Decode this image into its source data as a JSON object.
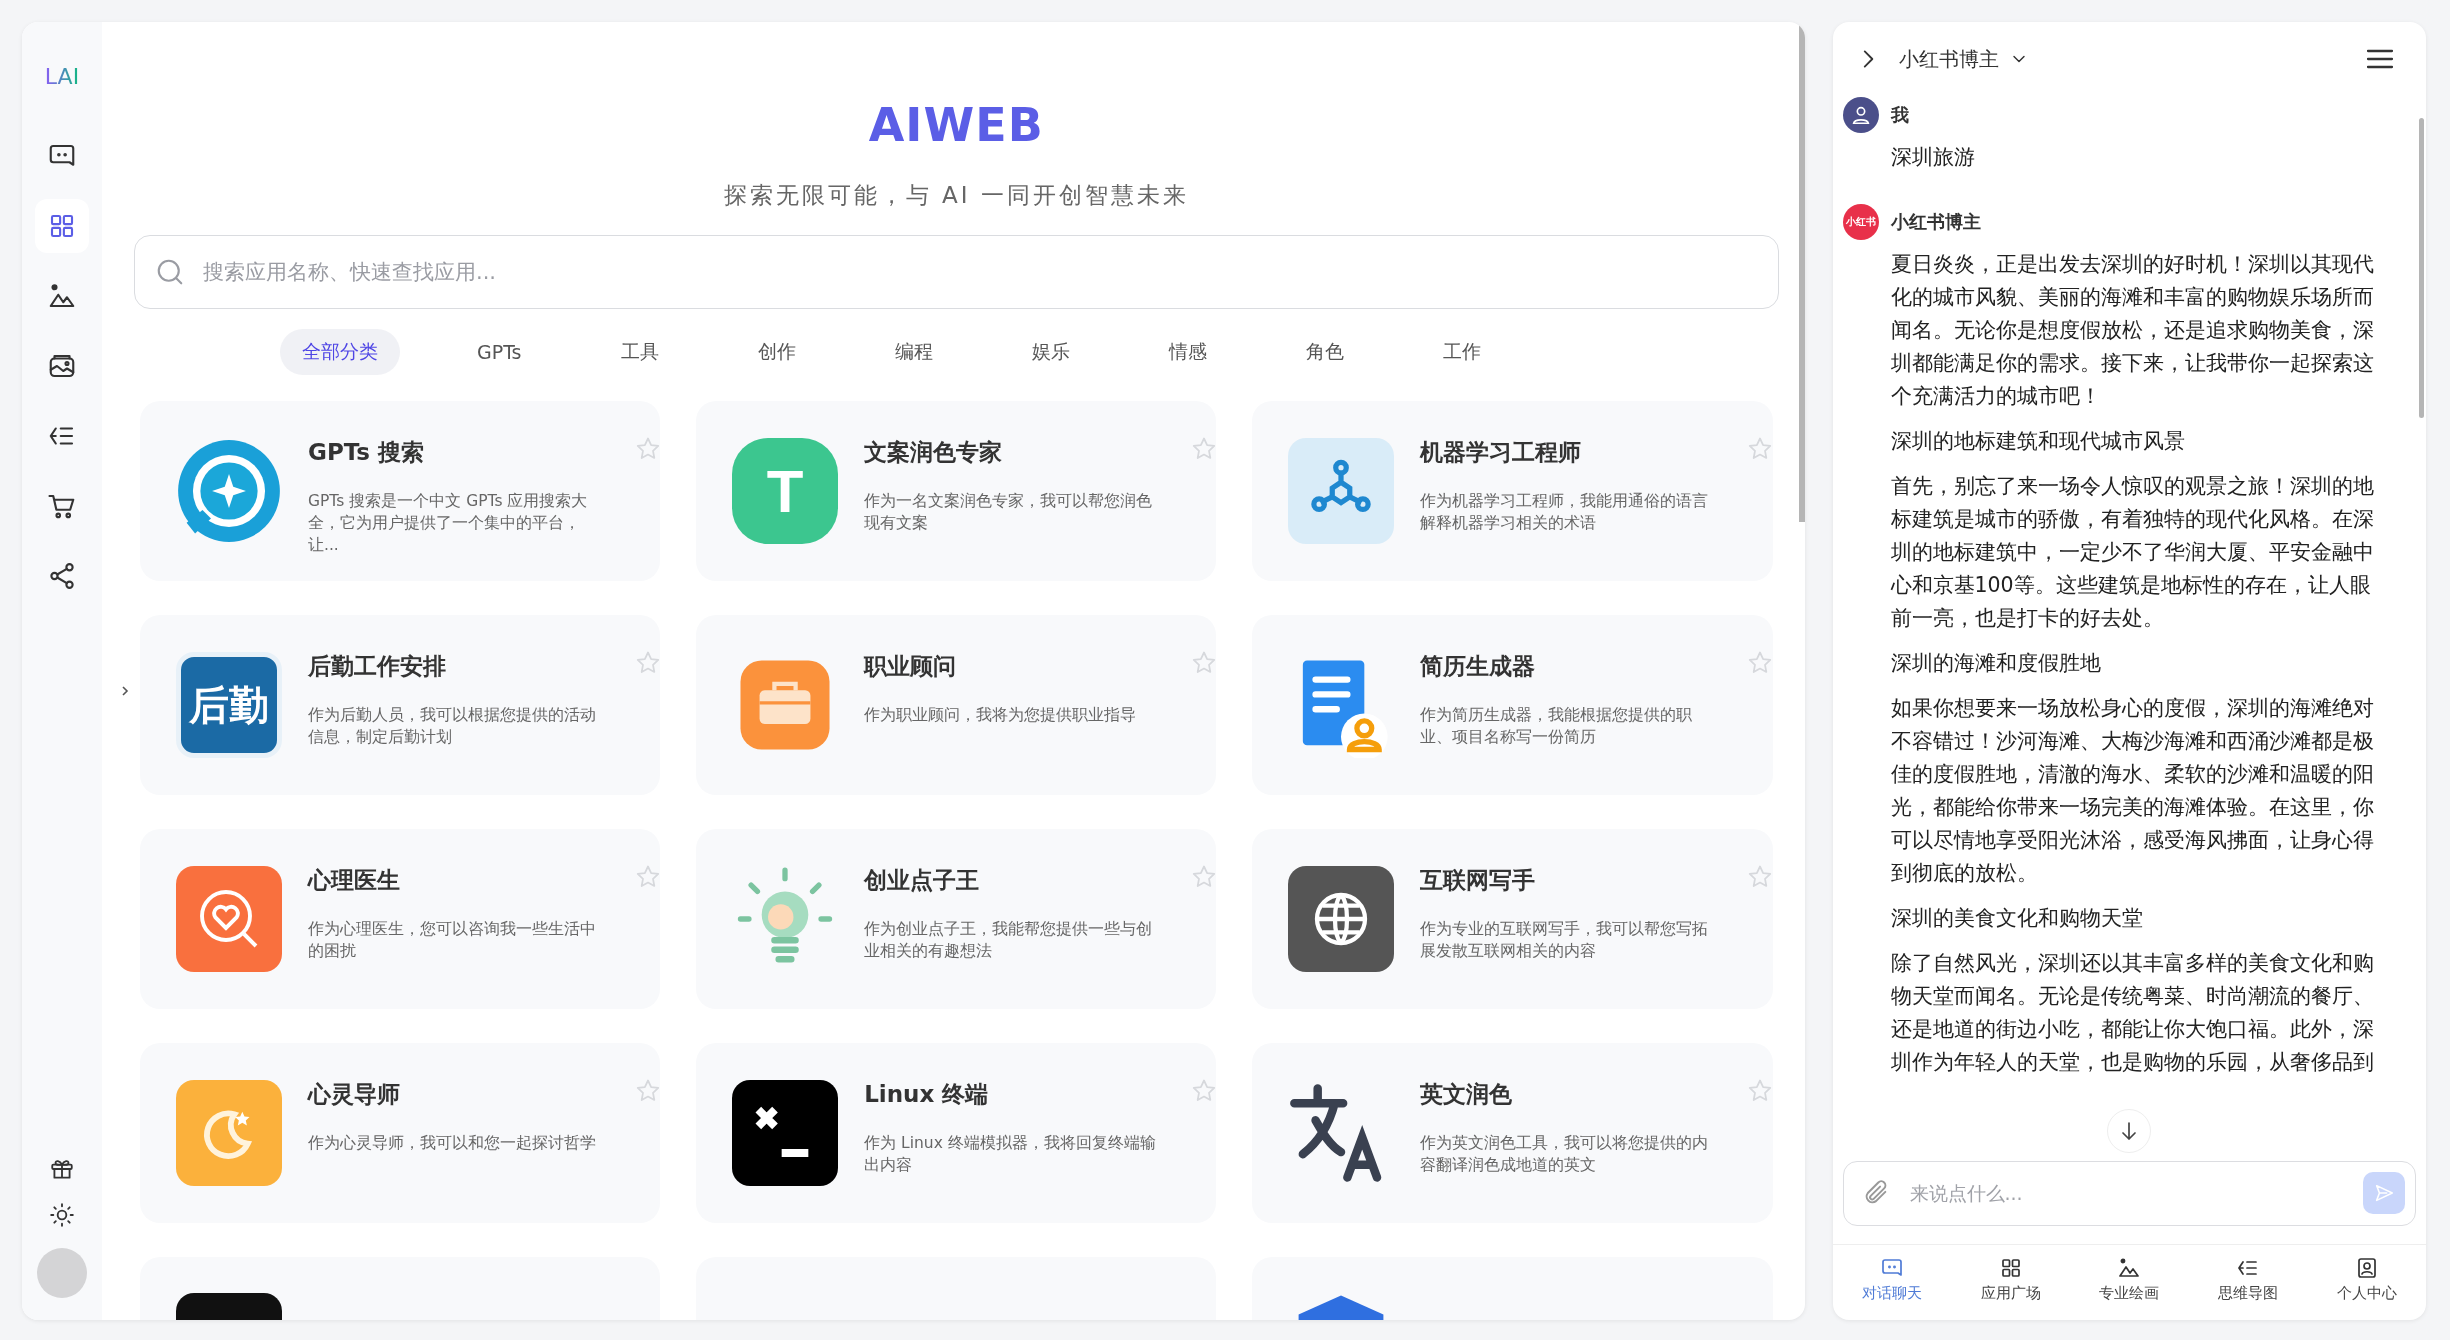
{
  "sidebar": {
    "logo": "LAI",
    "items": [
      {
        "kind": "chat",
        "selected": false
      },
      {
        "kind": "grid",
        "selected": true
      },
      {
        "kind": "paint",
        "selected": false
      },
      {
        "kind": "wallet",
        "selected": false
      },
      {
        "kind": "mindmap",
        "selected": false
      },
      {
        "kind": "cart",
        "selected": false
      },
      {
        "kind": "share",
        "selected": false
      }
    ],
    "bottom_items": [
      {
        "kind": "gift"
      },
      {
        "kind": "sun"
      }
    ]
  },
  "header": {
    "title": "AIWEB",
    "subtitle": "探索无限可能，与 AI 一同开创智慧未来"
  },
  "search": {
    "placeholder": "搜索应用名称、快速查找应用..."
  },
  "tabs": [
    {
      "label": "全部分类",
      "selected": true
    },
    {
      "label": "GPTs",
      "selected": false
    },
    {
      "label": "工具",
      "selected": false
    },
    {
      "label": "创作",
      "selected": false
    },
    {
      "label": "编程",
      "selected": false
    },
    {
      "label": "娱乐",
      "selected": false
    },
    {
      "label": "情感",
      "selected": false
    },
    {
      "label": "角色",
      "selected": false
    },
    {
      "label": "工作",
      "selected": false
    }
  ],
  "cards": [
    {
      "kind": "search-logo",
      "title": "GPTs 搜索",
      "description": "GPTs 搜索是一个中文 GPTs 应用搜索大全，它为用户提供了一个集中的平台，让...",
      "favorite": false
    },
    {
      "kind": "letter",
      "icon_text": "T",
      "title": "文案润色专家",
      "description": "作为一名文案润色专家，我可以帮您润色现有文案",
      "favorite": false
    },
    {
      "kind": "network",
      "title": "机器学习工程师",
      "description": "作为机器学习工程师，我能用通俗的语言解释机器学习相关的术语",
      "favorite": false
    },
    {
      "kind": "glyph",
      "icon_text": "后勤",
      "title": "后勤工作安排",
      "description": "作为后勤人员，我可以根据您提供的活动信息，制定后勤计划",
      "favorite": false
    },
    {
      "kind": "briefcase",
      "title": "职业顾问",
      "description": "作为职业顾问，我将为您提供职业指导",
      "favorite": false
    },
    {
      "kind": "resume",
      "title": "简历生成器",
      "description": "作为简历生成器，我能根据您提供的职业、项目名称写一份简历",
      "favorite": false
    },
    {
      "kind": "heart",
      "title": "心理医生",
      "description": "作为心理医生，您可以咨询我一些生活中的困扰",
      "favorite": false
    },
    {
      "kind": "bulb",
      "title": "创业点子王",
      "description": "作为创业点子王，我能帮您提供一些与创业相关的有趣想法",
      "favorite": false
    },
    {
      "kind": "globe",
      "title": "互联网写手",
      "description": "作为专业的互联网写手，我可以帮您写拓展发散互联网相关的内容",
      "favorite": false
    },
    {
      "kind": "moon",
      "title": "心灵导师",
      "description": "作为心灵导师，我可以和您一起探讨哲学",
      "favorite": false
    },
    {
      "kind": "terminal",
      "title": "Linux 终端",
      "description": "作为 Linux 终端模拟器，我将回复终端输出内容",
      "favorite": false
    },
    {
      "kind": "translate",
      "title": "英文润色",
      "description": "作为英文润色工具，我可以将您提供的内容翻译润色成地道的英文",
      "favorite": false
    },
    {
      "kind": "dark-block"
    },
    {
      "kind": "dot"
    },
    {
      "kind": "roof"
    }
  ],
  "chat": {
    "title": "小红书博主",
    "messages": [
      {
        "kind": "user",
        "name": "我",
        "paragraphs": [
          "深圳旅游"
        ]
      },
      {
        "kind": "bot",
        "name": "小红书博主",
        "avatar_text": "小红书",
        "paragraphs": [
          "夏日炎炎，正是出发去深圳的好时机！深圳以其现代化的城市风貌、美丽的海滩和丰富的购物娱乐场所而闻名。无论你是想度假放松，还是追求购物美食，深圳都能满足你的需求。接下来，让我带你一起探索这个充满活力的城市吧！",
          "深圳的地标建筑和现代城市风景",
          "首先，别忘了来一场令人惊叹的观景之旅！深圳的地标建筑是城市的骄傲，有着独特的现代化风格。在深圳的地标建筑中，一定少不了华润大厦、平安金融中心和京基100等。这些建筑是地标性的存在，让人眼前一亮，也是打卡的好去处。",
          "深圳的海滩和度假胜地",
          "如果你想要来一场放松身心的度假，深圳的海滩绝对不容错过！沙河海滩、大梅沙海滩和西涌沙滩都是极佳的度假胜地，清澈的海水、柔软的沙滩和温暖的阳光，都能给你带来一场完美的海滩体验。在这里，你可以尽情地享受阳光沐浴，感受海风拂面，让身心得到彻底的放松。",
          "深圳的美食文化和购物天堂",
          "除了自然风光，深圳还以其丰富多样的美食文化和购物天堂而闻名。无论是传统粤菜、时尚潮流的餐厅、还是地道的街边小吃，都能让你大饱口福。此外，深圳作为年轻人的天堂，也是购物的乐园，从奢侈品到"
        ]
      }
    ],
    "input": {
      "placeholder": "来说点什么..."
    },
    "nav": [
      {
        "kind": "chat",
        "label": "对话聊天",
        "selected": true
      },
      {
        "kind": "grid",
        "label": "应用广场",
        "selected": false
      },
      {
        "kind": "paint",
        "label": "专业绘画",
        "selected": false
      },
      {
        "kind": "mindmap",
        "label": "思维导图",
        "selected": false
      },
      {
        "kind": "profile",
        "label": "个人中心",
        "selected": false
      }
    ]
  }
}
